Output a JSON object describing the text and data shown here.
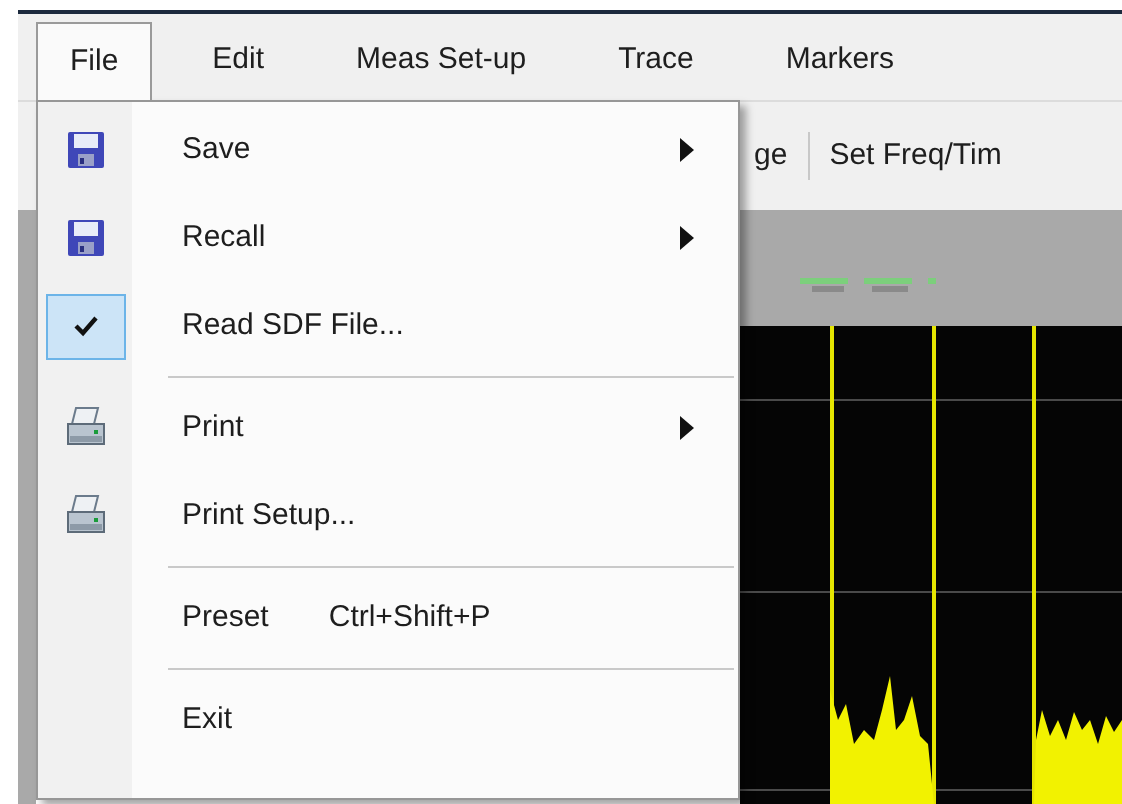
{
  "menubar": [
    {
      "label": "File",
      "selected": true
    },
    {
      "label": "Edit",
      "selected": false
    },
    {
      "label": "Meas Set-up",
      "selected": false
    },
    {
      "label": "Trace",
      "selected": false
    },
    {
      "label": "Markers",
      "selected": false
    }
  ],
  "toolbar": [
    "ge",
    "Set Freq/Tim"
  ],
  "file_menu": [
    {
      "kind": "item",
      "label": "Save",
      "submenu": true,
      "checked": false
    },
    {
      "kind": "item",
      "label": "Recall",
      "submenu": true,
      "checked": false
    },
    {
      "kind": "item",
      "label": "Read SDF File...",
      "submenu": false,
      "checked": true
    },
    {
      "kind": "separator"
    },
    {
      "kind": "item",
      "label": "Print",
      "submenu": true,
      "checked": false
    },
    {
      "kind": "item",
      "label": "Print Setup...",
      "submenu": false,
      "checked": false
    },
    {
      "kind": "separator"
    },
    {
      "kind": "item",
      "label": "Preset",
      "shortcut": "Ctrl+Shift+P",
      "submenu": false,
      "checked": false
    },
    {
      "kind": "separator"
    },
    {
      "kind": "item",
      "label": "Exit",
      "submenu": false,
      "checked": false
    }
  ]
}
